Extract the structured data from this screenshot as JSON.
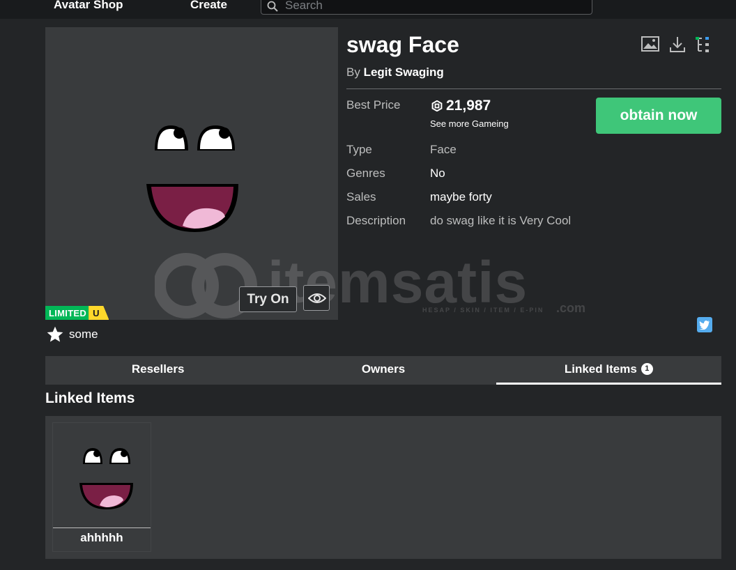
{
  "nav": {
    "avatar_shop": "Avatar Shop",
    "create": "Create",
    "search_placeholder": "Search"
  },
  "item": {
    "title": "swag Face",
    "by_prefix": "By",
    "creator": "Legit Swaging",
    "best_price_label": "Best Price",
    "price": "21,987",
    "see_more": "See more Gameing",
    "obtain_label": "obtain now",
    "details": [
      {
        "label": "Type",
        "value": "Face"
      },
      {
        "label": "Genres",
        "value": "No"
      },
      {
        "label": "Sales",
        "value": "maybe forty"
      },
      {
        "label": "Description",
        "value": "do swag like it is Very Cool"
      }
    ],
    "limited_label": "LIMITED",
    "limited_u": "U",
    "try_on": "Try On",
    "favorites": "some"
  },
  "tabs": [
    {
      "label": "Resellers"
    },
    {
      "label": "Owners"
    },
    {
      "label": "Linked Items",
      "count": "1"
    }
  ],
  "linked": {
    "section_title": "Linked Items",
    "items": [
      {
        "name": "ahhhhh"
      }
    ]
  },
  "watermark": {
    "brand": "itemsatis",
    "sub": "HESAP / SKIN / ITEM / E-PIN",
    "domain": ".com"
  },
  "colors": {
    "background": "#232527",
    "panel": "#393b3d",
    "obtain_button": "#3fc679",
    "limited_green": "#02b757",
    "limited_yellow": "#ffd82b",
    "twitter": "#55acee"
  }
}
